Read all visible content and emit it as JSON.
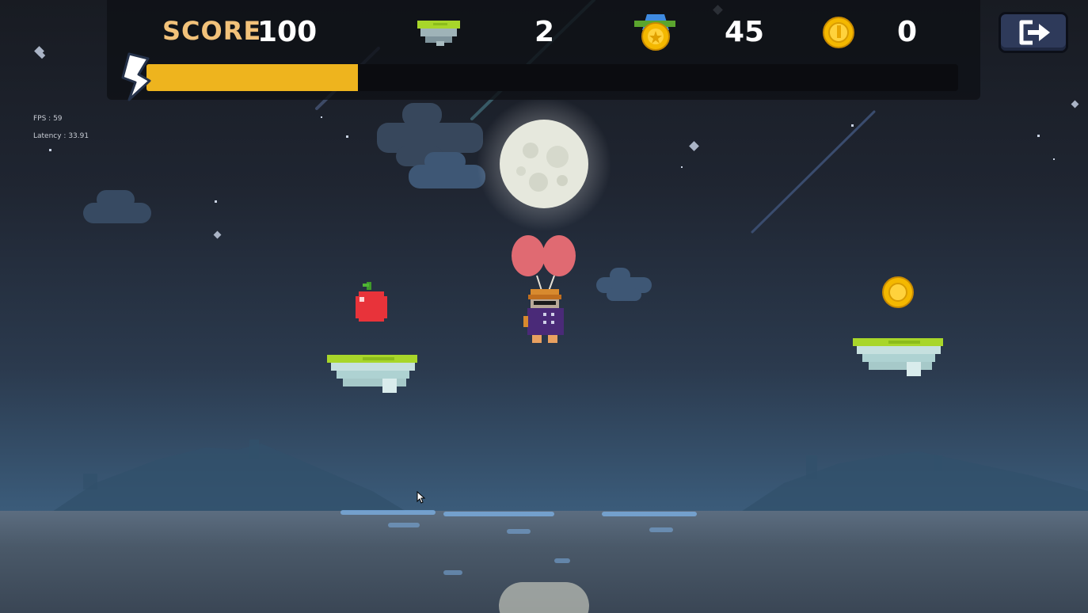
{
  "hud": {
    "score_label": "SCORE",
    "score_value": "100",
    "platform_count": "2",
    "medal_count": "45",
    "coin_count": "0",
    "energy_fraction": 0.26
  },
  "debug": {
    "fps": "FPS : 59",
    "latency": "Latency : 33.91"
  },
  "icons": {
    "energy": "lightning-bolt-icon",
    "platform": "platform-icon",
    "medal": "medal-icon",
    "coin": "coin-icon",
    "exit": "exit-icon"
  },
  "colors": {
    "score_label": "#f2c27a",
    "energy_fill": "#eeb41e",
    "exit_button": "#2e3a5a",
    "platform_top": "#a8d62a",
    "coin": "#f4b800",
    "apple": "#e8333a",
    "balloon": "#e06a72"
  }
}
